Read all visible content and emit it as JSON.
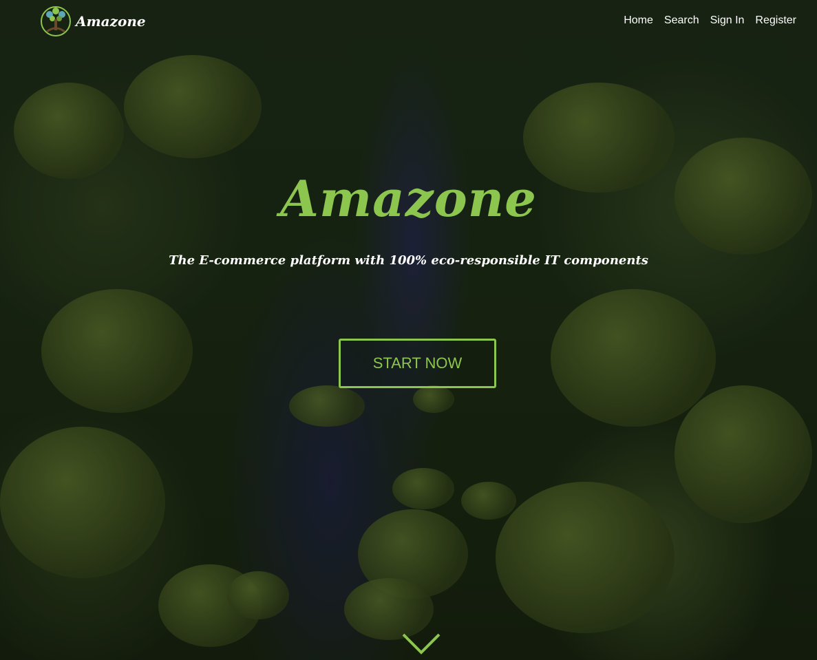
{
  "nav": {
    "brand": "Amazone",
    "links": [
      "Home",
      "Search",
      "Sign In",
      "Register"
    ]
  },
  "hero": {
    "title": "Amazone",
    "subtitle": "The E-commerce platform with 100% eco-responsible IT components",
    "cta_label": "START NOW",
    "scroll_icon": "chevron-down-icon"
  },
  "colors": {
    "accent": "#8dc64f",
    "text": "#ffffff"
  }
}
